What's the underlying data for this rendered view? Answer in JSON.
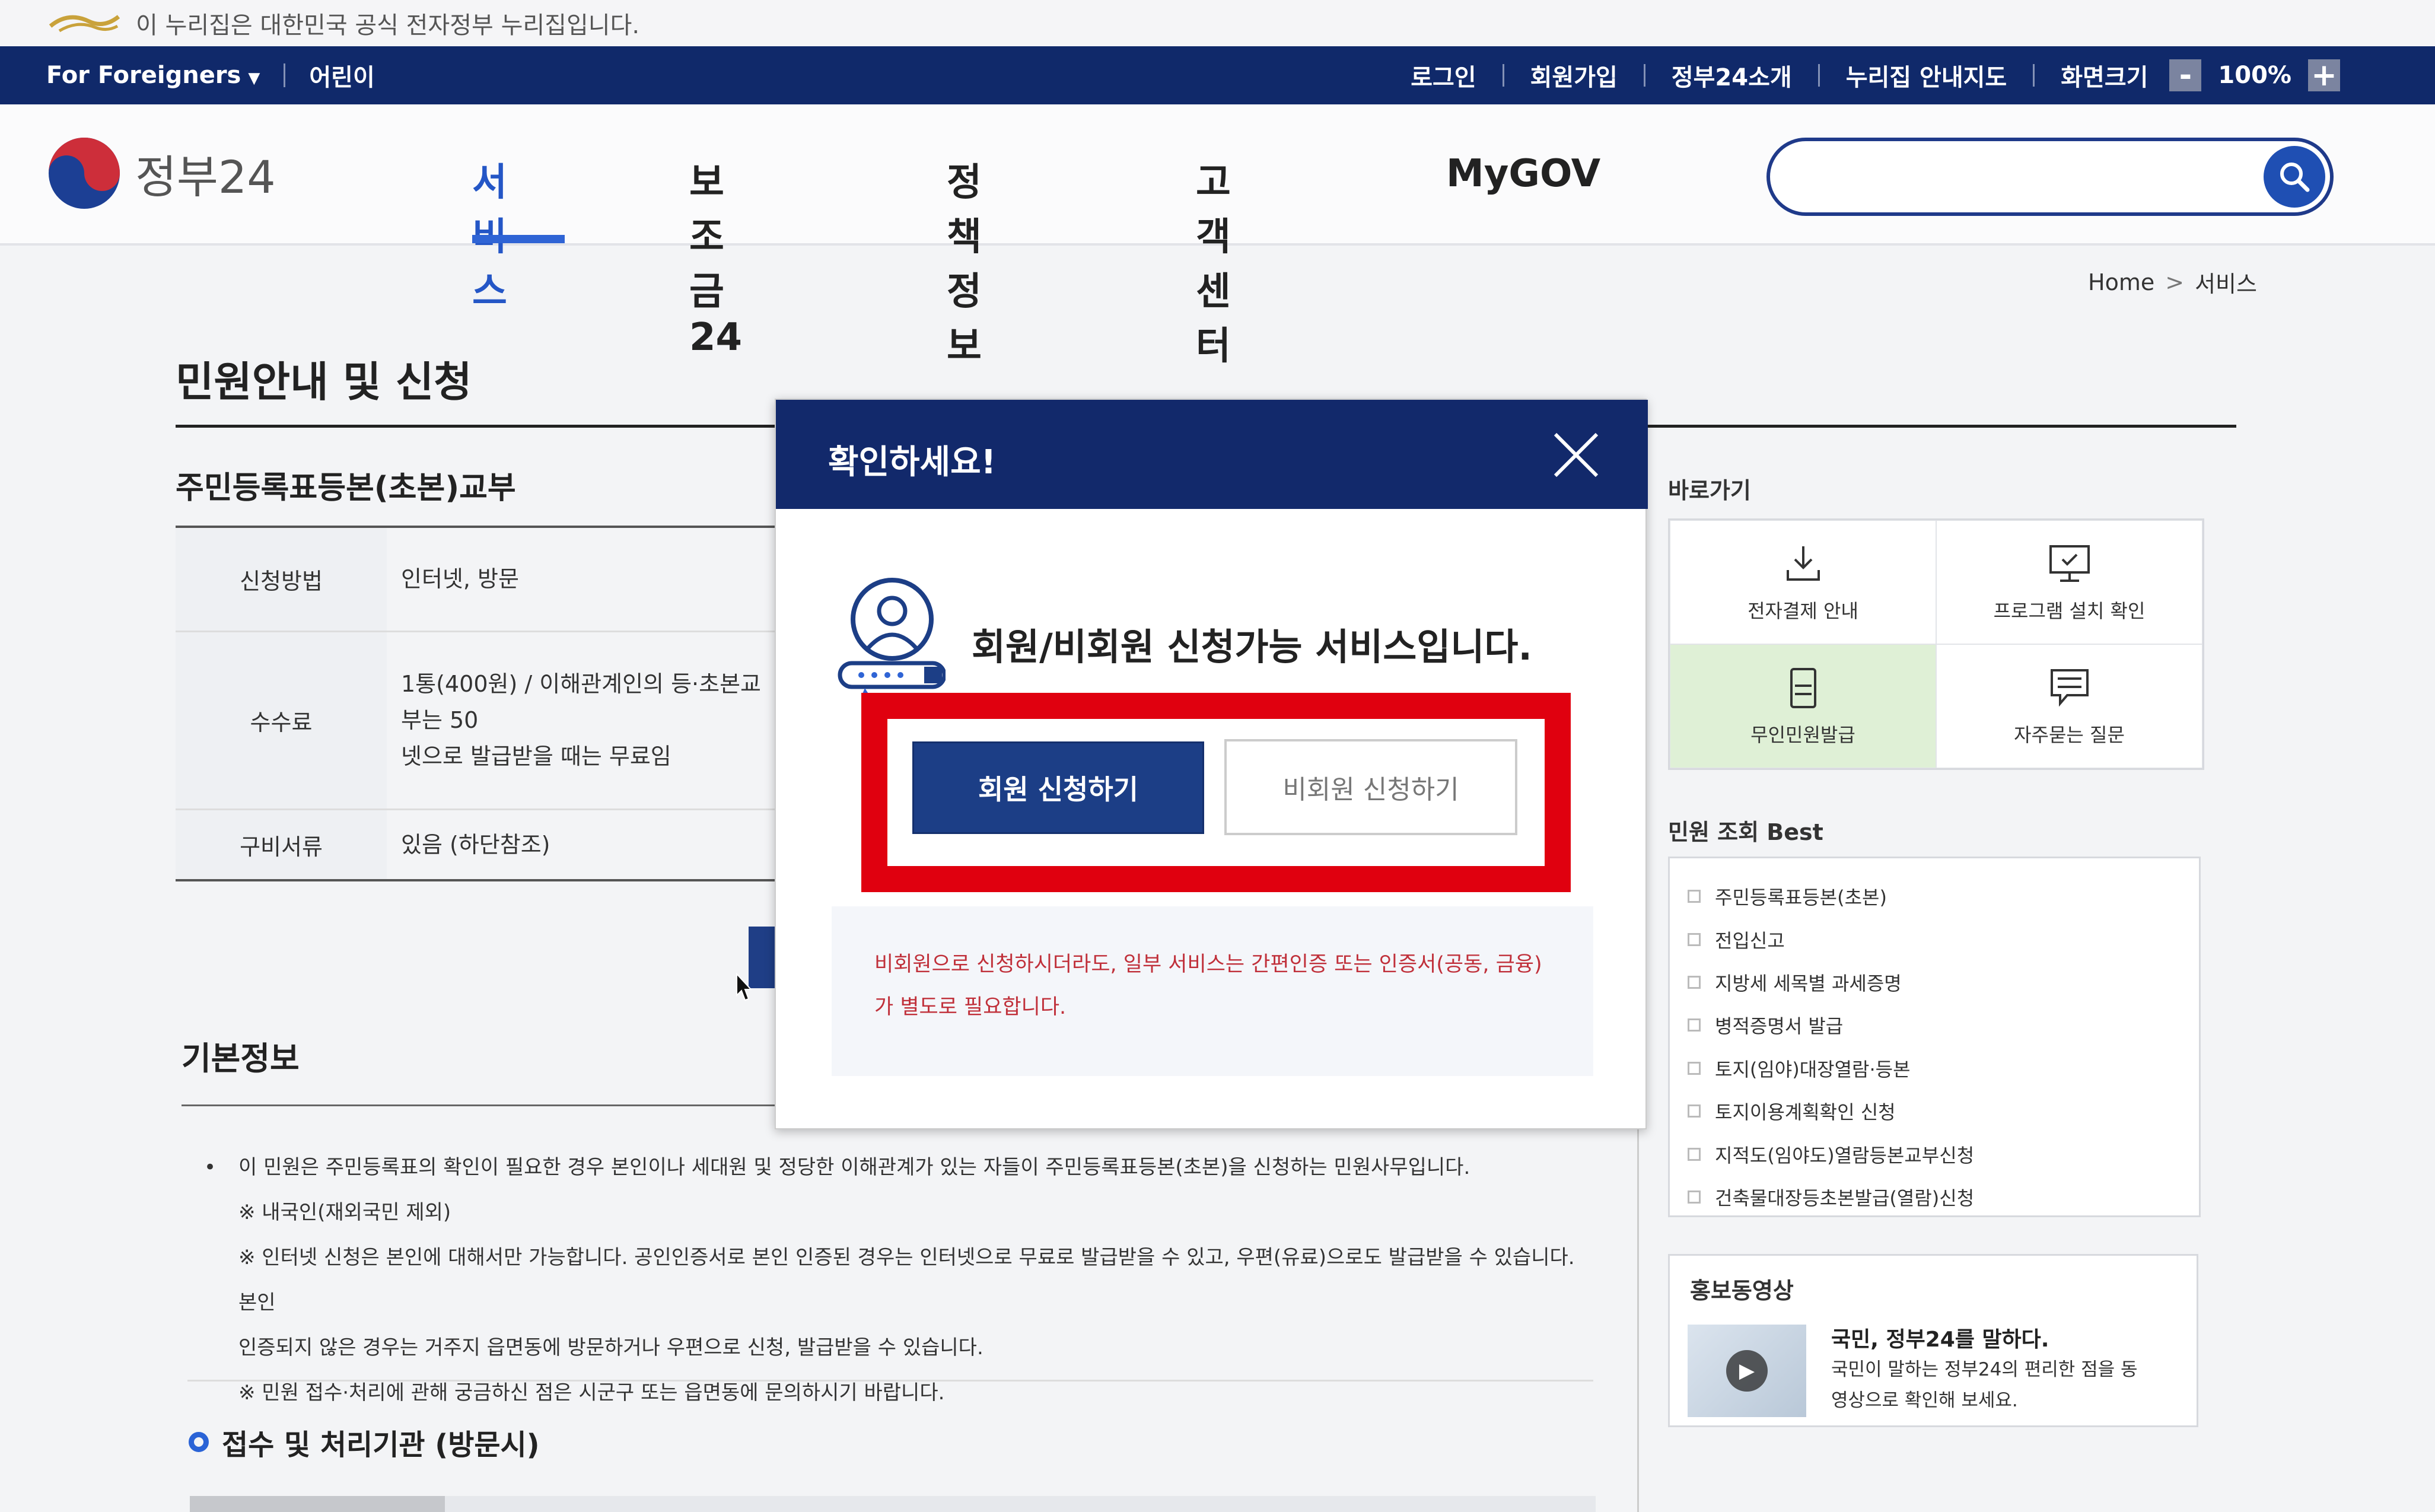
{
  "banner": {
    "text": "이 누리집은 대한민국 공식 전자정부 누리집입니다."
  },
  "util": {
    "foreigners": "For Foreigners",
    "kids": "어린이",
    "links": [
      "로그인",
      "회원가입",
      "정부24소개",
      "누리집 안내지도"
    ],
    "zoom_label": "화면크기",
    "zoom_minus": "-",
    "zoom_value": "100%",
    "zoom_plus": "+"
  },
  "header": {
    "brand": "정부24",
    "nav": [
      "서비스",
      "보조금24",
      "정책정보",
      "고객센터",
      "MyGOV"
    ],
    "active_nav": "서비스"
  },
  "breadcrumb": {
    "home": "Home",
    "chev": ">",
    "current": "서비스"
  },
  "page": {
    "title": "민원안내 및 신청",
    "service_name": "주민등록표등본(초본)교부",
    "table": [
      {
        "label": "신청방법",
        "value": "인터넷, 방문"
      },
      {
        "label": "수수료",
        "value": "1통(400원) / 이해관계인의 등·초본교부는 50",
        "value2": "넷으로 발급받을 때는 무료임"
      },
      {
        "label": "구비서류",
        "value": "있음 (하단참조)"
      }
    ]
  },
  "basic": {
    "title": "기본정보",
    "bullet": "•",
    "notes": [
      "이 민원은 주민등록표의 확인이 필요한 경우 본인이나 세대원 및 정당한 이해관계가 있는 자들이 주민등록표등본(초본)을 신청하는 민원사무입니다.",
      "※ 내국인(재외국민 제외)",
      "※ 인터넷 신청은 본인에 대해서만 가능합니다. 공인인증서로 본인 인증된 경우는 인터넷으로 무료로 발급받을 수 있고, 우편(유료)으로도 발급받을 수 있습니다. 본인",
      "인증되지 않은 경우는 거주지 읍면동에 방문하거나 우편으로 신청, 발급받을 수 있습니다.",
      "※ 민원 접수·처리에 관해 궁금하신 점은 시군구 또는 읍면동에 문의하시기 바랍니다."
    ],
    "section2": "접수 및 처리기관 (방문시)"
  },
  "sidebar": {
    "quick_title": "바로가기",
    "quick": [
      {
        "label": "전자결제 안내",
        "icon": "download-icon"
      },
      {
        "label": "프로그램 설치 확인",
        "icon": "monitor-check-icon"
      },
      {
        "label": "무인민원발급",
        "icon": "kiosk-icon"
      },
      {
        "label": "자주묻는 질문",
        "icon": "chat-icon"
      }
    ],
    "best_title": "민원 조회 Best",
    "best": [
      "주민등록표등본(초본)",
      "전입신고",
      "지방세 세목별 과세증명",
      "병적증명서 발급",
      "토지(임야)대장열람·등본",
      "토지이용계획확인 신청",
      "지적도(임야도)열람등본교부신청",
      "건축물대장등초본발급(열람)신청"
    ],
    "promo_title": "홍보동영상",
    "promo_head": "국민, 정부24를 말하다.",
    "promo_desc": "국민이 말하는 정부24의 편리한 점을 동영상으로 확인해 보세요."
  },
  "modal": {
    "title": "확인하세요!",
    "message": "회원/비회원 신청가능 서비스입니다.",
    "member_button": "회원 신청하기",
    "guest_button": "비회원 신청하기",
    "note": "비회원으로 신청하시더라도, 일부 서비스는 간편인증 또는 인증서(공동, 금융)가 별도로 필요합니다."
  },
  "colors": {
    "navy": "#12296b",
    "accent_blue": "#2f64d5",
    "highlight_red": "#e0000f",
    "note_red": "#c0303a"
  }
}
